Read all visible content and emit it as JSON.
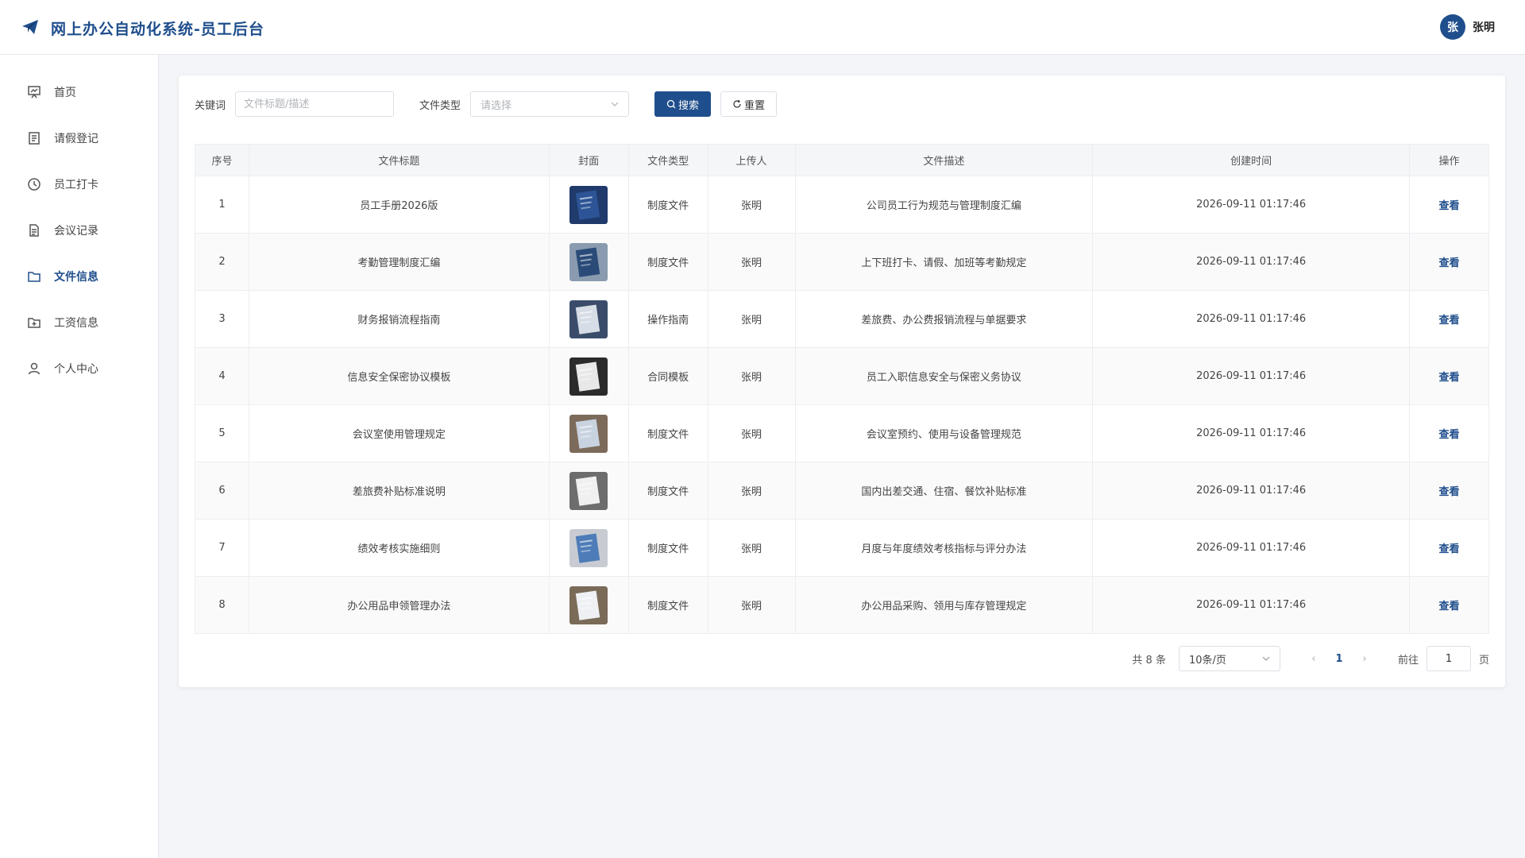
{
  "header": {
    "title": "网上办公自动化系统-员工后台",
    "avatar_text": "张",
    "username": "张明"
  },
  "sidebar": {
    "items": [
      {
        "label": "首页",
        "icon": "dashboard-icon"
      },
      {
        "label": "请假登记",
        "icon": "document-icon"
      },
      {
        "label": "员工打卡",
        "icon": "clock-icon"
      },
      {
        "label": "会议记录",
        "icon": "file-text-icon"
      },
      {
        "label": "文件信息",
        "icon": "folder-icon",
        "active": true
      },
      {
        "label": "工资信息",
        "icon": "folder-add-icon"
      },
      {
        "label": "个人中心",
        "icon": "user-icon"
      }
    ]
  },
  "filters": {
    "keyword_label": "关键词",
    "keyword_placeholder": "文件标题/描述",
    "type_label": "文件类型",
    "type_placeholder": "请选择",
    "search_label": "搜索",
    "reset_label": "重置"
  },
  "table": {
    "columns": [
      "序号",
      "文件标题",
      "封面",
      "文件类型",
      "上传人",
      "文件描述",
      "创建时间",
      "操作"
    ],
    "rows": [
      {
        "index": "1",
        "title": "员工手册2026版",
        "type": "制度文件",
        "uploader": "张明",
        "desc": "公司员工行为规范与管理制度汇编",
        "time": "2026-09-11 01:17:46",
        "action": "查看"
      },
      {
        "index": "2",
        "title": "考勤管理制度汇编",
        "type": "制度文件",
        "uploader": "张明",
        "desc": "上下班打卡、请假、加班等考勤规定",
        "time": "2026-09-11 01:17:46",
        "action": "查看"
      },
      {
        "index": "3",
        "title": "财务报销流程指南",
        "type": "操作指南",
        "uploader": "张明",
        "desc": "差旅费、办公费报销流程与单据要求",
        "time": "2026-09-11 01:17:46",
        "action": "查看"
      },
      {
        "index": "4",
        "title": "信息安全保密协议模板",
        "type": "合同模板",
        "uploader": "张明",
        "desc": "员工入职信息安全与保密义务协议",
        "time": "2026-09-11 01:17:46",
        "action": "查看"
      },
      {
        "index": "5",
        "title": "会议室使用管理规定",
        "type": "制度文件",
        "uploader": "张明",
        "desc": "会议室预约、使用与设备管理规范",
        "time": "2026-09-11 01:17:46",
        "action": "查看"
      },
      {
        "index": "6",
        "title": "差旅费补贴标准说明",
        "type": "制度文件",
        "uploader": "张明",
        "desc": "国内出差交通、住宿、餐饮补贴标准",
        "time": "2026-09-11 01:17:46",
        "action": "查看"
      },
      {
        "index": "7",
        "title": "绩效考核实施细则",
        "type": "制度文件",
        "uploader": "张明",
        "desc": "月度与年度绩效考核指标与评分办法",
        "time": "2026-09-11 01:17:46",
        "action": "查看"
      },
      {
        "index": "8",
        "title": "办公用品申领管理办法",
        "type": "制度文件",
        "uploader": "张明",
        "desc": "办公用品采购、领用与库存管理规定",
        "time": "2026-09-11 01:17:46",
        "action": "查看"
      }
    ]
  },
  "pagination": {
    "total_text": "共 8 条",
    "page_size": "10条/页",
    "current_page": "1",
    "goto_label": "前往",
    "goto_value": "1",
    "page_suffix": "页"
  },
  "colors": {
    "accent": "#1f4e8c"
  }
}
